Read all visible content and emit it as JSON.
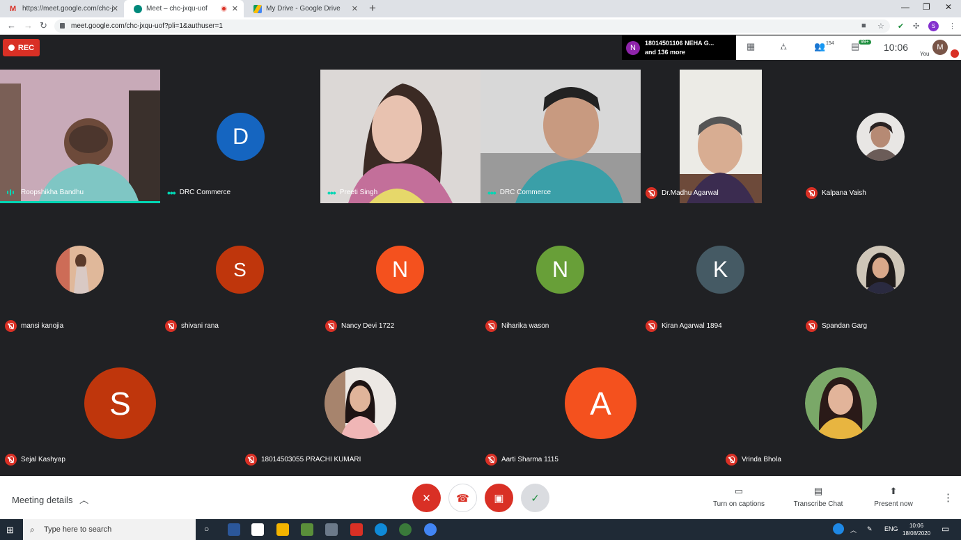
{
  "browser": {
    "tabs": [
      {
        "label": "https://meet.google.com/chc-jxq",
        "icon": "gmail-icon"
      },
      {
        "label": "Meet – chc-jxqu-uof",
        "icon": "meet-icon",
        "active": true
      },
      {
        "label": "My Drive - Google Drive",
        "icon": "drive-icon"
      }
    ],
    "url": "meet.google.com/chc-jxqu-uof?pli=1&authuser=1",
    "profile_initial": "S"
  },
  "meet": {
    "rec_label": "REC",
    "presenter": {
      "initial": "N",
      "line1": "18014501106 NEHA G...",
      "line2": "and 136 more"
    },
    "people_count": "154",
    "chat_badge": "99+",
    "time": "10:06",
    "you_label": "You",
    "my_initial": "M",
    "tiles": [
      {
        "name": "Roopshikha Bandhu",
        "status": "speaking"
      },
      {
        "name": "DRC Commerce",
        "status": "dots",
        "initial": "D",
        "color": "#1565c0"
      },
      {
        "name": "Preeti Singh",
        "status": "dots"
      },
      {
        "name": "DRC Commerce",
        "status": "dots"
      },
      {
        "name": "Dr.Madhu Agarwal",
        "status": "muted"
      },
      {
        "name": "Kalpana Vaish",
        "status": "muted"
      },
      {
        "name": "mansi kanojia",
        "status": "muted"
      },
      {
        "name": "shivani rana",
        "status": "muted",
        "initial": "S",
        "color": "#bf360c"
      },
      {
        "name": "Nancy Devi 1722",
        "status": "muted",
        "initial": "N",
        "color": "#f4511e"
      },
      {
        "name": "Niharika wason",
        "status": "muted",
        "initial": "N",
        "color": "#689f38"
      },
      {
        "name": "Kiran Agarwal 1894",
        "status": "muted",
        "initial": "K",
        "color": "#455a64"
      },
      {
        "name": "Spandan Garg",
        "status": "muted"
      },
      {
        "name": "Sejal Kashyap",
        "status": "muted",
        "initial": "S",
        "color": "#bf360c"
      },
      {
        "name": "18014503055 PRACHI KUMARI",
        "status": "muted"
      },
      {
        "name": "Aarti Sharma 1115",
        "status": "muted",
        "initial": "A",
        "color": "#f4511e"
      },
      {
        "name": "Vrinda Bhola",
        "status": "muted"
      }
    ],
    "bottom": {
      "details": "Meeting details",
      "captions": "Turn on captions",
      "transcribe": "Transcribe Chat",
      "present": "Present now"
    }
  },
  "taskbar": {
    "search_placeholder": "Type here to search",
    "lang": "ENG",
    "time": "10:06",
    "date": "18/08/2020"
  }
}
